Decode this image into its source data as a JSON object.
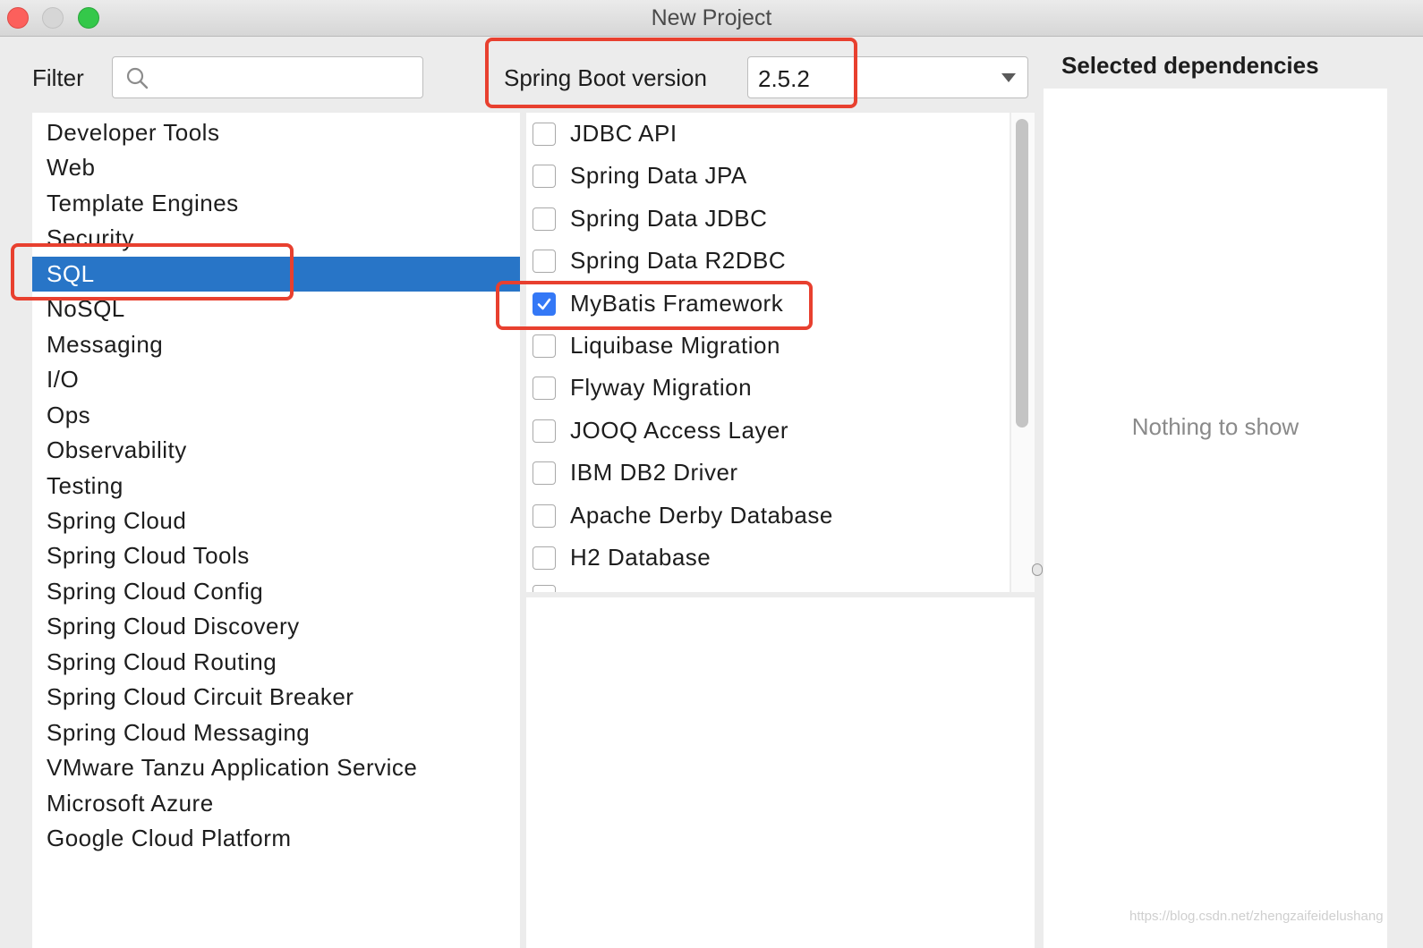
{
  "window": {
    "title": "New Project"
  },
  "filter": {
    "label": "Filter",
    "value": "",
    "icon": "search-icon"
  },
  "spring_boot": {
    "label": "Spring Boot version",
    "value": "2.5.2"
  },
  "categories": [
    {
      "label": "Developer Tools",
      "selected": false
    },
    {
      "label": "Web",
      "selected": false
    },
    {
      "label": "Template Engines",
      "selected": false
    },
    {
      "label": "Security",
      "selected": false
    },
    {
      "label": "SQL",
      "selected": true
    },
    {
      "label": "NoSQL",
      "selected": false
    },
    {
      "label": "Messaging",
      "selected": false
    },
    {
      "label": "I/O",
      "selected": false
    },
    {
      "label": "Ops",
      "selected": false
    },
    {
      "label": "Observability",
      "selected": false
    },
    {
      "label": "Testing",
      "selected": false
    },
    {
      "label": "Spring Cloud",
      "selected": false
    },
    {
      "label": "Spring Cloud Tools",
      "selected": false
    },
    {
      "label": "Spring Cloud Config",
      "selected": false
    },
    {
      "label": "Spring Cloud Discovery",
      "selected": false
    },
    {
      "label": "Spring Cloud Routing",
      "selected": false
    },
    {
      "label": "Spring Cloud Circuit Breaker",
      "selected": false
    },
    {
      "label": "Spring Cloud Messaging",
      "selected": false
    },
    {
      "label": "VMware Tanzu Application Service",
      "selected": false
    },
    {
      "label": "Microsoft Azure",
      "selected": false
    },
    {
      "label": "Google Cloud Platform",
      "selected": false
    }
  ],
  "dependencies": [
    {
      "label": "JDBC API",
      "checked": false
    },
    {
      "label": "Spring Data JPA",
      "checked": false
    },
    {
      "label": "Spring Data JDBC",
      "checked": false
    },
    {
      "label": "Spring Data R2DBC",
      "checked": false
    },
    {
      "label": "MyBatis Framework",
      "checked": true
    },
    {
      "label": "Liquibase Migration",
      "checked": false
    },
    {
      "label": "Flyway Migration",
      "checked": false
    },
    {
      "label": "JOOQ Access Layer",
      "checked": false
    },
    {
      "label": "IBM DB2 Driver",
      "checked": false
    },
    {
      "label": "Apache Derby Database",
      "checked": false
    },
    {
      "label": "H2 Database",
      "checked": false
    }
  ],
  "selected_dependencies": {
    "heading": "Selected dependencies",
    "empty_text": "Nothing to show"
  },
  "watermark": "https://blog.csdn.net/zhengzaifeidelushang",
  "colors": {
    "selection": "#2875c7",
    "checkbox_checked": "#3478f6",
    "annotation": "#e8402f"
  }
}
